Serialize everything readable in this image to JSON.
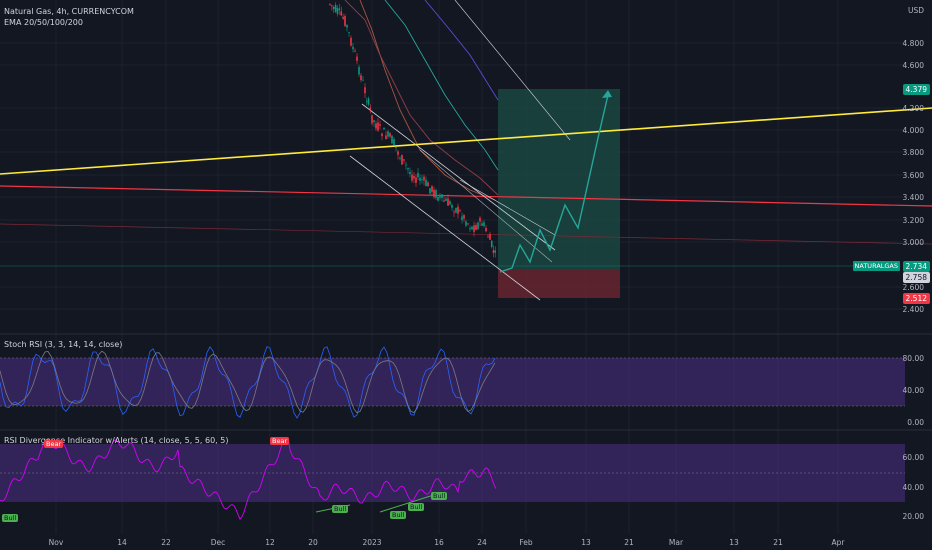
{
  "header": {
    "symbol_line": "Natural Gas, 4h, CURRENCYCOM",
    "ema_line": "EMA 20/50/100/200"
  },
  "price_axis": {
    "currency": "USD",
    "ticks": [
      "4.800",
      "4.600",
      "4.200",
      "4.000",
      "3.800",
      "3.600",
      "3.400",
      "3.200",
      "3.000",
      "2.600",
      "2.400"
    ]
  },
  "price_tags": {
    "target": "4.379",
    "symbol": "NATURALGAS",
    "current": "2.734",
    "crosshair": "2.758",
    "stop": "2.512"
  },
  "stoch_pane": {
    "legend": "Stoch RSI (3, 3, 14, 14, close)",
    "ticks": [
      "80.00",
      "40.00",
      "0.00"
    ]
  },
  "rsi_pane": {
    "legend": "RSI Divergence Indicator w/Alerts (14, close, 5, 5, 60, 5)",
    "ticks": [
      "60.00",
      "40.00",
      "20.00"
    ],
    "signals": [
      "Bull",
      "Bear",
      "Bear",
      "Bull",
      "Bull",
      "Bull",
      "Bull"
    ]
  },
  "time_axis": {
    "labels": [
      "Nov",
      "14",
      "22",
      "Dec",
      "12",
      "20",
      "2023",
      "16",
      "24",
      "Feb",
      "13",
      "21",
      "Mar",
      "13",
      "21",
      "Apr"
    ]
  },
  "colors": {
    "background": "#131722",
    "trendline_yellow": "#ffeb3b",
    "trendline_red": "#f23645",
    "target_zone": "#1b4d45",
    "stop_zone": "#6b2530",
    "stoch_fill": "#3d2a6b",
    "rsi_line": "#d500f9"
  }
}
